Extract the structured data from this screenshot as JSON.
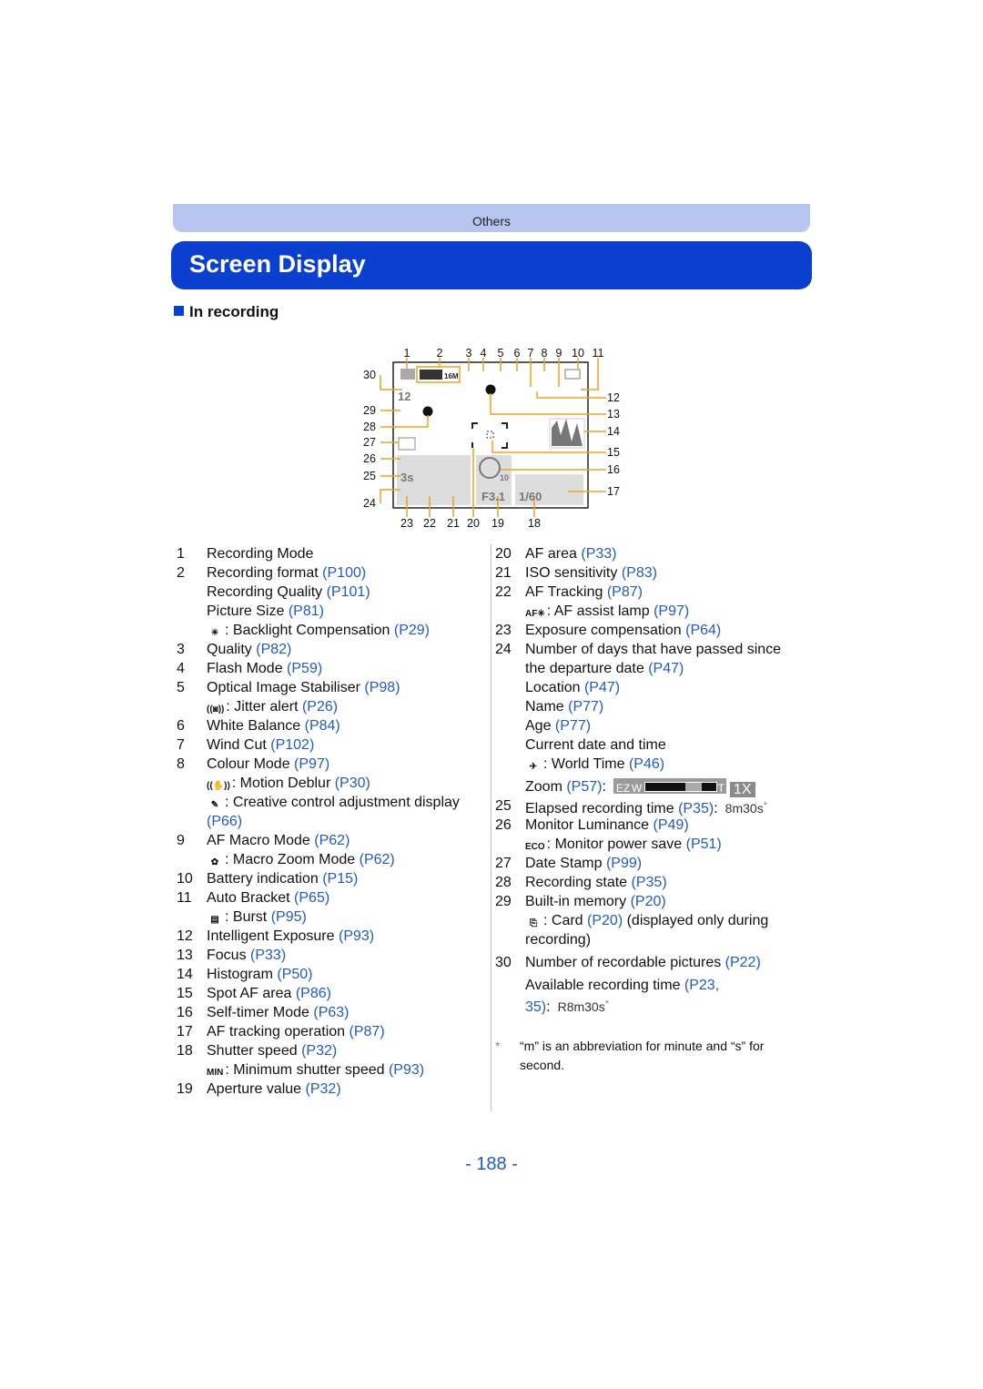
{
  "header": {
    "section": "Others",
    "title": "Screen Display",
    "subsection": "In recording"
  },
  "colors": {
    "title_bar": "#0b3fcf",
    "band": "#b7c6f0",
    "link": "#2158cf",
    "callout": "#f0a020"
  },
  "diagram": {
    "labels_top": [
      "1",
      "2",
      "3",
      "4",
      "5",
      "6",
      "7",
      "8",
      "9",
      "10",
      "11"
    ],
    "labels_right": [
      "12",
      "13",
      "14",
      "15",
      "16",
      "17"
    ],
    "labels_bottom": [
      "23",
      "22",
      "21",
      "20",
      "19",
      "18"
    ],
    "labels_left": [
      "30",
      "29",
      "28",
      "27",
      "26",
      "25",
      "24"
    ],
    "osd": {
      "pictures": "12",
      "burst_time": "3s",
      "aperture": "F3.1",
      "shutter": "1/60",
      "timer": "10",
      "quality": "16M"
    }
  },
  "left_items": [
    {
      "num": "1",
      "text": "Recording Mode"
    },
    {
      "num": "2",
      "text": "Recording format ",
      "ref": "(P100)"
    },
    {
      "text": "Recording Quality ",
      "ref": "(P101)"
    },
    {
      "text": "Picture Size ",
      "ref": "(P81)"
    },
    {
      "icon": "backlight-compensation-icon",
      "glyph": "☀",
      "text": ": Backlight Compensation ",
      "ref": "(P29)"
    },
    {
      "num": "3",
      "text": "Quality ",
      "ref": "(P82)"
    },
    {
      "num": "4",
      "text": "Flash Mode ",
      "ref": "(P59)"
    },
    {
      "num": "5",
      "text": "Optical Image Stabiliser ",
      "ref": "(P98)"
    },
    {
      "icon": "jitter-alert-icon",
      "glyph": "((◙))",
      "text": ": Jitter alert ",
      "ref": "(P26)"
    },
    {
      "num": "6",
      "text": "White Balance ",
      "ref": "(P84)"
    },
    {
      "num": "7",
      "text": "Wind Cut ",
      "ref": "(P102)"
    },
    {
      "num": "8",
      "text": "Colour Mode ",
      "ref": "(P97)"
    },
    {
      "icon": "motion-deblur-icon",
      "glyph": "((✋))",
      "text": ": Motion Deblur ",
      "ref": "(P30)"
    },
    {
      "icon": "creative-control-icon",
      "glyph": "✎",
      "text": ": Creative control adjustment display"
    },
    {
      "ref": "(P66)"
    },
    {
      "num": "9",
      "text": "AF Macro Mode ",
      "ref": "(P62)"
    },
    {
      "icon": "macro-zoom-icon",
      "glyph": "✿",
      "text": ":  Macro Zoom Mode ",
      "ref": "(P62)"
    },
    {
      "num": "10",
      "text": "Battery indication ",
      "ref": "(P15)"
    },
    {
      "num": "11",
      "text": "Auto Bracket ",
      "ref": "(P65)"
    },
    {
      "icon": "burst-icon",
      "glyph": "▤",
      "text": ": Burst ",
      "ref": "(P95)"
    },
    {
      "num": "12",
      "text": "Intelligent Exposure ",
      "ref": "(P93)"
    },
    {
      "num": "13",
      "text": "Focus ",
      "ref": "(P33)"
    },
    {
      "num": "14",
      "text": "Histogram ",
      "ref": "(P50)"
    },
    {
      "num": "15",
      "text": "Spot AF area ",
      "ref": "(P86)"
    },
    {
      "num": "16",
      "text": "Self-timer Mode ",
      "ref": "(P63)"
    },
    {
      "num": "17",
      "text": "AF tracking operation ",
      "ref": "(P87)"
    },
    {
      "num": "18",
      "text": "Shutter speed ",
      "ref": "(P32)"
    },
    {
      "icon": "minimum-shutter-icon",
      "glyph": "MIN",
      "text": ": Minimum shutter speed ",
      "ref": "(P93)"
    },
    {
      "num": "19",
      "text": "Aperture value ",
      "ref": "(P32)"
    }
  ],
  "right_items": [
    {
      "num": "20",
      "text": "AF area ",
      "ref": "(P33)"
    },
    {
      "num": "21",
      "text": "ISO sensitivity ",
      "ref": "(P83)"
    },
    {
      "num": "22",
      "text": "AF Tracking ",
      "ref": "(P87)"
    },
    {
      "icon": "af-assist-icon",
      "glyph": "AF✳",
      "text": ":  AF assist lamp ",
      "ref": "(P97)"
    },
    {
      "num": "23",
      "text": "Exposure compensation ",
      "ref": "(P64)"
    },
    {
      "num": "24",
      "text": "Number of days that have passed since"
    },
    {
      "text": "the departure date ",
      "ref": "(P47)"
    },
    {
      "text": "Location ",
      "ref": "(P47)"
    },
    {
      "text": "Name ",
      "ref": "(P77)"
    },
    {
      "text": "Age ",
      "ref": "(P77)"
    },
    {
      "text": "Current date and time"
    },
    {
      "icon": "world-time-icon",
      "glyph": "✈",
      "text": ": World Time ",
      "ref": "(P46)"
    },
    {
      "text": "Zoom ",
      "ref": "(P57)",
      "suffix": ":",
      "zoom": {
        "ez": "EZ",
        "w": "W",
        "t": "T",
        "value": "1X"
      },
      "gap": 4
    },
    {
      "num": "25",
      "text": "Elapsed recording time ",
      "ref": "(P35)",
      "suffix": ":",
      "osd": "8m30s",
      "ast": "*"
    },
    {
      "num": "26",
      "text": "Monitor Luminance ",
      "ref": "(P49)"
    },
    {
      "icon": "eco-icon",
      "glyph": "ECO",
      "text": ": Monitor power save ",
      "ref": "(P51)"
    },
    {
      "num": "27",
      "text": "Date Stamp ",
      "ref": "(P99)"
    },
    {
      "num": "28",
      "text": "Recording state ",
      "ref": "(P35)"
    },
    {
      "num": "29",
      "text": "Built-in memory ",
      "ref": "(P20)"
    },
    {
      "icon": "card-icon",
      "glyph": "⎘",
      "text": ": Card ",
      "ref": "(P20)",
      "suffix": " (displayed only during"
    },
    {
      "text": "recording)"
    },
    {
      "num": "30",
      "text": "Number of recordable pictures ",
      "ref": "(P22)",
      "gap": 4
    },
    {
      "text": "Available recording time ",
      "ref": "(P23,",
      "gap": 4
    },
    {
      "ref": "35)",
      "suffix": ":",
      "osd": "R8m30s",
      "ast": "*"
    }
  ],
  "footnote": {
    "mark": "*",
    "text": "“m” is an abbreviation for minute and “s” for second."
  },
  "page_number": "- 188 -"
}
